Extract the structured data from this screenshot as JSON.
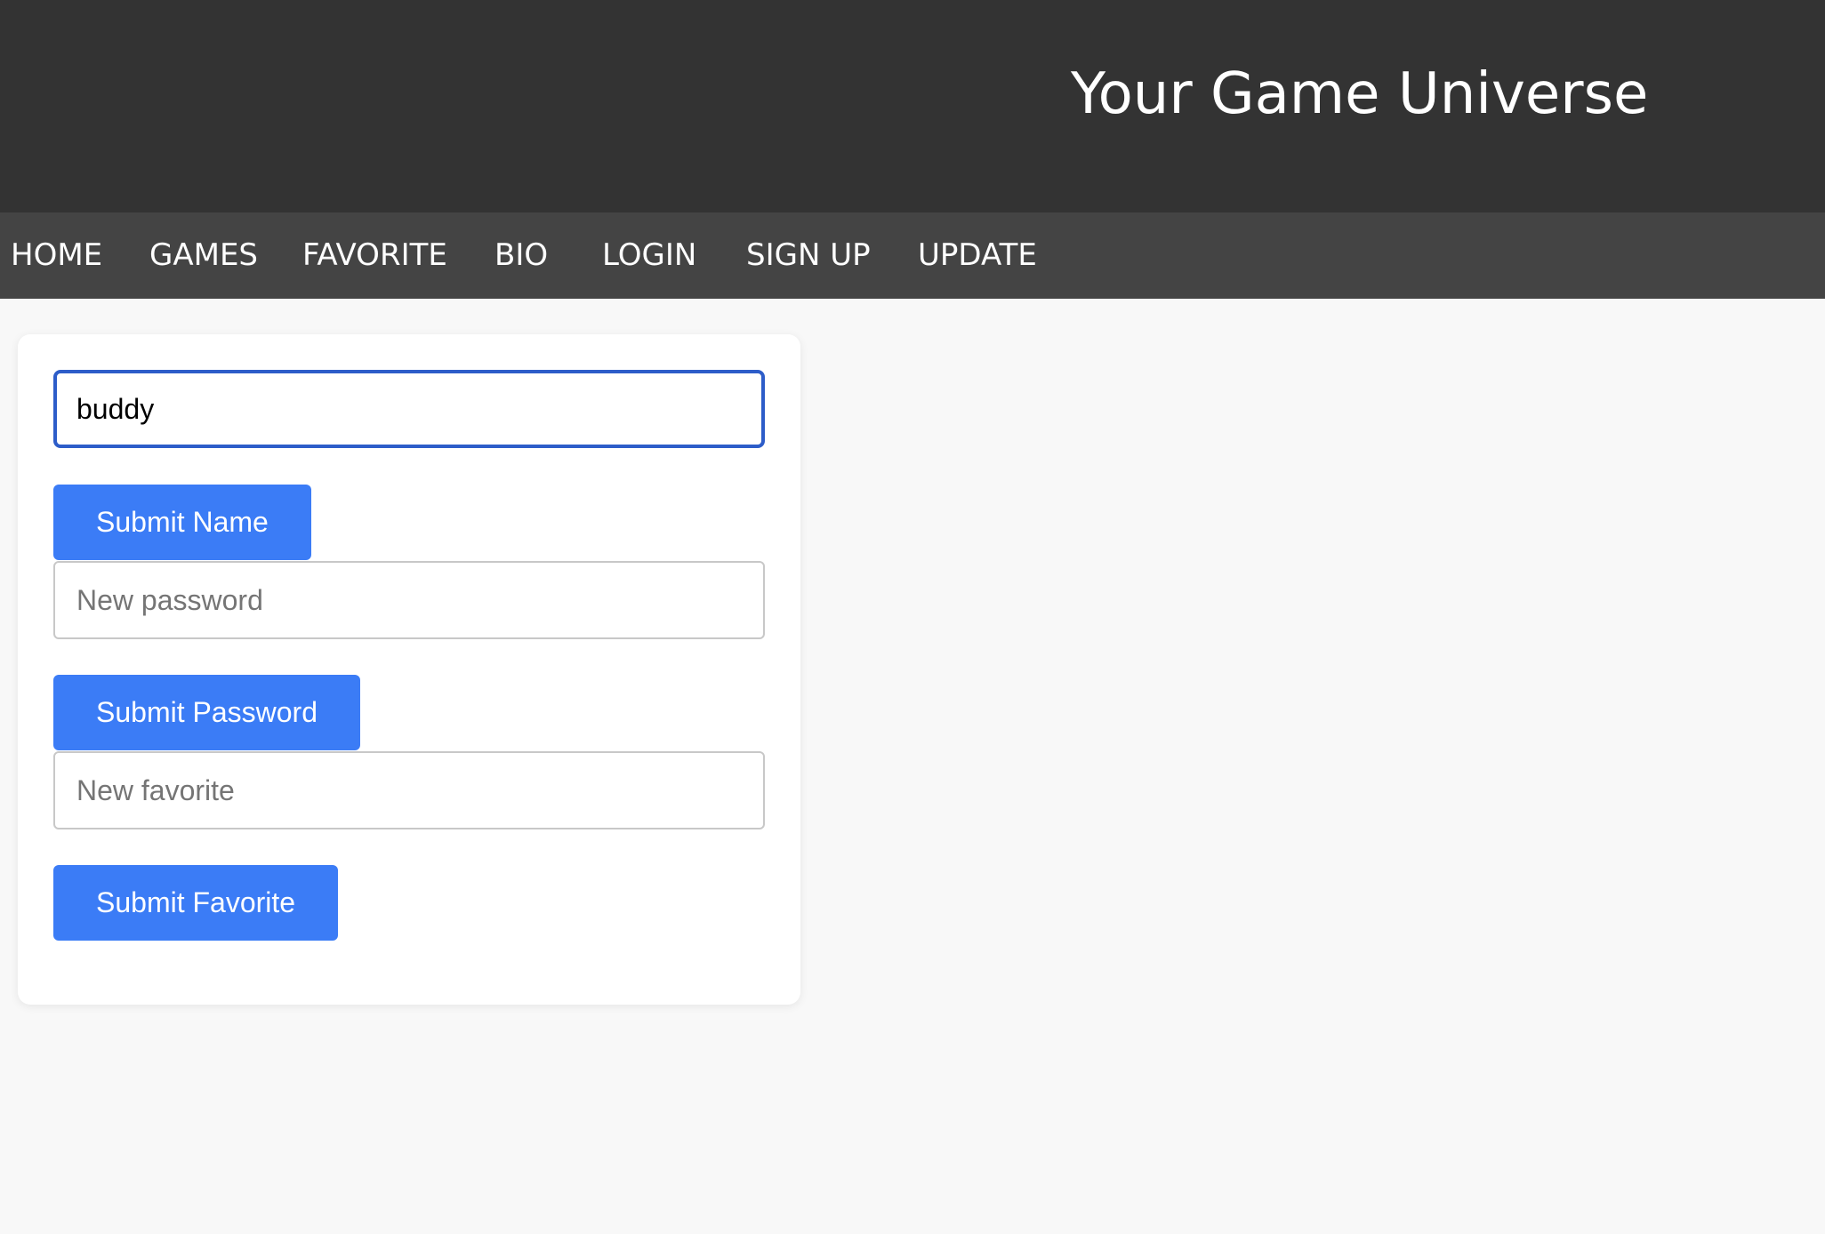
{
  "header": {
    "title": "Your Game Universe"
  },
  "nav": {
    "items": [
      {
        "label": "HOME"
      },
      {
        "label": "GAMES"
      },
      {
        "label": "FAVORITE"
      },
      {
        "label": "BIO"
      },
      {
        "label": "LOGIN"
      },
      {
        "label": "SIGN UP"
      },
      {
        "label": "UPDATE"
      }
    ]
  },
  "form": {
    "name_input": {
      "value": "buddy",
      "placeholder": ""
    },
    "submit_name_label": "Submit Name",
    "password_input": {
      "value": "",
      "placeholder": "New password"
    },
    "submit_password_label": "Submit Password",
    "favorite_input": {
      "value": "",
      "placeholder": "New favorite"
    },
    "submit_favorite_label": "Submit Favorite"
  },
  "colors": {
    "header_bg": "#333333",
    "nav_bg": "#444444",
    "page_bg": "#f8f8f8",
    "button_bg": "#3b7cf6",
    "focus_border": "#2d5dc9"
  }
}
